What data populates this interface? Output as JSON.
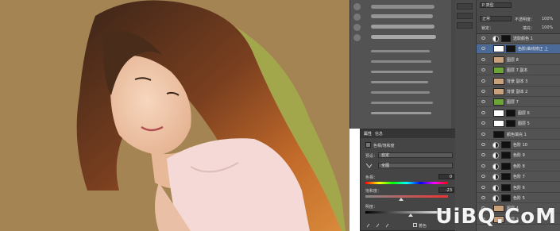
{
  "properties_panel": {
    "tabs": [
      "属性",
      "信息"
    ],
    "title": "色相/饱和度",
    "preset_label": "预设：",
    "preset_value": "自定",
    "channel_value": "全图",
    "hue_label": "色相：",
    "hue_value": "0",
    "saturation_label": "饱和度：",
    "saturation_value": "-23",
    "lightness_label": "明度：",
    "colorize_label": "着色"
  },
  "layers_panel": {
    "kind_label": "P 类型",
    "blend_mode": "正常",
    "opacity_label": "不透明度：",
    "opacity_value": "100%",
    "lock_label": "锁定：",
    "fill_label": "填充：",
    "fill_value": "100%",
    "layers": [
      {
        "name": "选取颜色 1",
        "type": "adjust"
      },
      {
        "name": "色阶/曲线修正 上",
        "type": "mask",
        "selected": true
      },
      {
        "name": "图层 8",
        "type": "photo"
      },
      {
        "name": "图层 7 副本",
        "type": "green"
      },
      {
        "name": "背景 副本 3",
        "type": "photo"
      },
      {
        "name": "背景 副本 2",
        "type": "photo"
      },
      {
        "name": "图层 7",
        "type": "green"
      },
      {
        "name": "图层 6",
        "type": "mask"
      },
      {
        "name": "图层 5",
        "type": "mask"
      },
      {
        "name": "颜色填充 1",
        "type": "fill"
      },
      {
        "name": "色阶 10",
        "type": "adjust"
      },
      {
        "name": "色阶 9",
        "type": "adjust"
      },
      {
        "name": "色阶 8",
        "type": "adjust"
      },
      {
        "name": "色阶 7",
        "type": "adjust"
      },
      {
        "name": "色阶 6",
        "type": "adjust"
      },
      {
        "name": "色阶 5",
        "type": "adjust"
      },
      {
        "name": "图层 4",
        "type": "photo"
      },
      {
        "name": "图层 3",
        "type": "photo"
      }
    ]
  },
  "watermark": "UiBQ.CoM",
  "colors": {
    "canvas_bg": "#a58453",
    "panel_bg": "#535353",
    "selected_layer": "#4b6a97",
    "selection_edge": "#b5d64a"
  }
}
